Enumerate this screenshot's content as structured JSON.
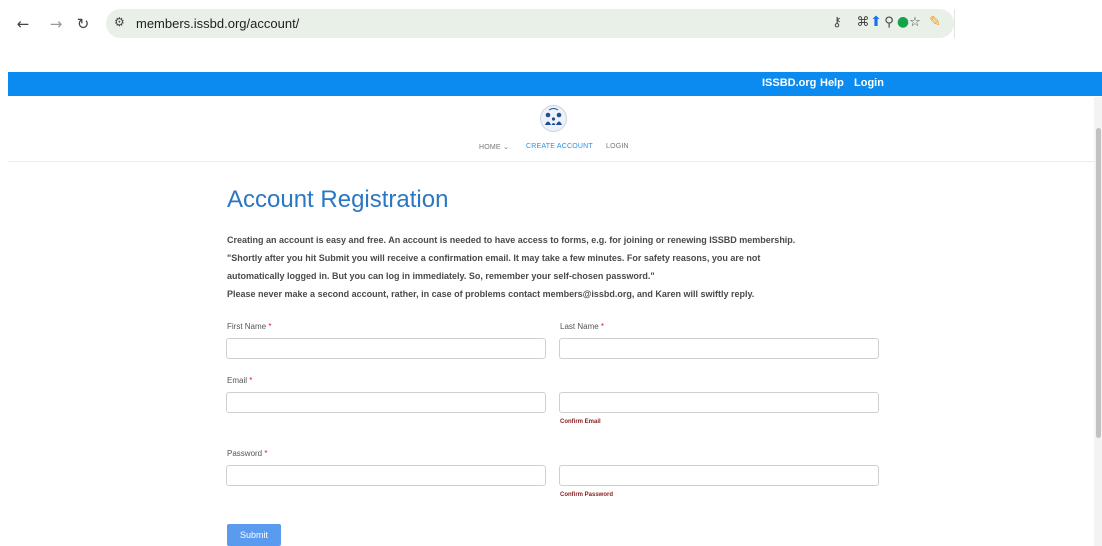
{
  "browser": {
    "url": "members.issbd.org/account/",
    "back_icon": "arrow-left-icon",
    "forward_icon": "arrow-right-icon",
    "reload_icon": "reload-icon"
  },
  "topbar": {
    "links": [
      "ISSBD.org",
      "Help",
      "Login"
    ],
    "color": "#0b8bf0"
  },
  "nav": {
    "home": "HOME ⌄",
    "create_account": "CREATE ACCOUNT",
    "login": "LOGIN"
  },
  "page": {
    "title": "Account Registration",
    "intro": [
      "Creating an account is easy and free. An account is needed to have access to forms, e.g. for joining or renewing ISSBD membership.",
      "\"Shortly after you hit Submit you will receive a confirmation email. It may take a few minutes. For safety reasons, you are not",
      "automatically logged in. But you can log in immediately. So, remember your self-chosen password.\"",
      "Please never make a second account, rather, in case of problems contact members@issbd.org, and Karen will swiftly reply."
    ]
  },
  "form": {
    "first_name_label": "First Name",
    "last_name_label": "Last Name",
    "email_label": "Email",
    "confirm_email_label": "Confirm Email",
    "password_label": "Password",
    "confirm_password_label": "Confirm Password",
    "required_mark": "*",
    "submit_label": "Submit"
  }
}
